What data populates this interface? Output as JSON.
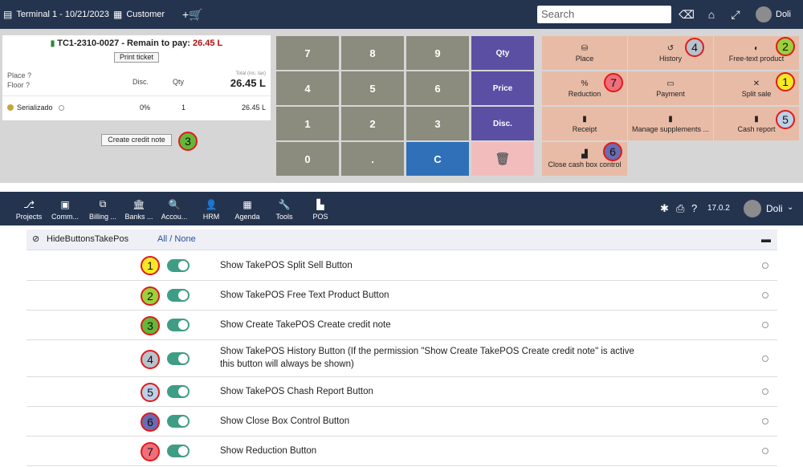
{
  "pos": {
    "terminal": "Terminal 1 - 10/21/2023",
    "customer": "Customer",
    "search_placeholder": "Search",
    "user": "Doli",
    "ticket_ref": "TC1-2310-0027",
    "remain_label": " - Remain to pay: ",
    "remain_amount": "26.45 L",
    "print_ticket": "Print ticket",
    "place_label": "Place ?",
    "floor_label": "Floor ?",
    "col_disc": "Disc.",
    "col_qty": "Qty",
    "total_caption": "Total (inc. tax)",
    "total_value": "26.45 L",
    "line": {
      "product": "Serializado",
      "disc": "0%",
      "qty": "1",
      "amount": "26.45 L"
    },
    "create_credit_note": "Create credit note",
    "keys": [
      "7",
      "8",
      "9",
      "Qty",
      "4",
      "5",
      "6",
      "Price",
      "1",
      "2",
      "3",
      "Disc.",
      "0",
      ".",
      "C",
      "🗑"
    ],
    "actions": [
      "Place",
      "History",
      "Free-text product",
      "Reduction",
      "Payment",
      "Split sale",
      "Receipt",
      "Manage supplements ...",
      "Cash report",
      "Close cash box control"
    ]
  },
  "markers": [
    "1",
    "2",
    "3",
    "4",
    "5",
    "6",
    "7"
  ],
  "admin": {
    "menu": [
      "Projects",
      "Comm...",
      "Billing ...",
      "Banks ...",
      "Accou...",
      "HRM",
      "Agenda",
      "Tools",
      "POS"
    ],
    "version": "17.0.2",
    "user": "Doli",
    "section_title": "HideButtonsTakePos",
    "all_none": "All / None",
    "settings": [
      "Show TakePOS Split Sell Button",
      "Show TakePOS Free Text Product Button",
      "Show Create TakePOS Create credit note",
      "Show TakePOS History Button (If the permission \"Show Create TakePOS Create credit note\" is active this button will always be shown)",
      "Show TakePOS Chash Report Button",
      "Show Close Box Control Button",
      "Show Reduction Button"
    ]
  },
  "colors": {
    "topbar": "#24344f",
    "action_bg": "#e8bba6",
    "numkey": "#8b8b7e",
    "purple_key": "#5b4fa4",
    "clear_key": "#2f70b8",
    "toggle_on": "#3f9d85"
  },
  "icons": [
    "register-icon",
    "customer-icon",
    "add-cart-icon",
    "backspace-icon",
    "home-icon",
    "fullscreen-icon",
    "user-avatar",
    "trash-icon",
    "bug-icon",
    "print-icon",
    "help-icon",
    "eye-slash-icon",
    "folder-icon"
  ]
}
